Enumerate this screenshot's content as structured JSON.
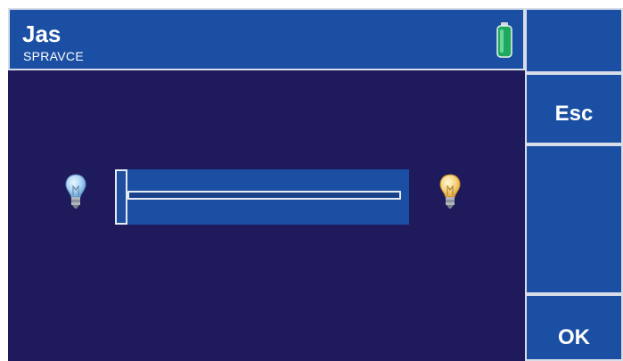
{
  "header": {
    "title": "Jas",
    "subtitle": "SPRAVCE"
  },
  "buttons": {
    "esc_label": "Esc",
    "ok_label": "OK"
  },
  "brightness": {
    "level": 0.0
  },
  "icons": {
    "battery": "battery-icon",
    "dim": "bulb-dim-icon",
    "bright": "bulb-bright-icon"
  },
  "colors": {
    "background": "#1f1a5c",
    "panel": "#1a4fa3",
    "border": "#d8dde8",
    "battery": "#2fbf71"
  }
}
